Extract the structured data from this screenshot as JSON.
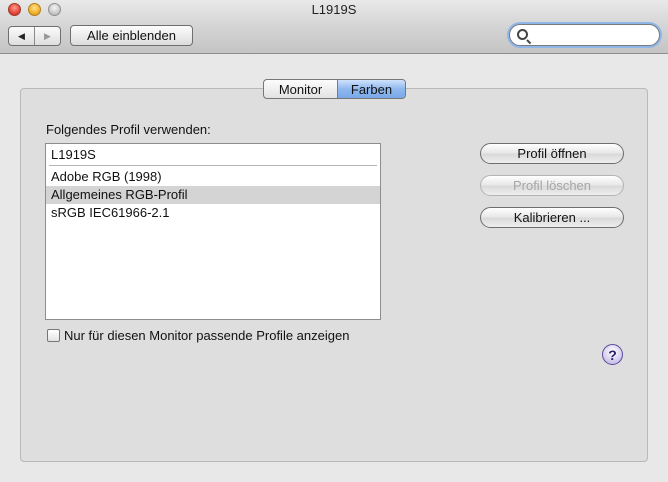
{
  "window": {
    "title": "L1919S"
  },
  "toolbar": {
    "back_icon": "◀",
    "forward_icon": "▶",
    "show_all_label": "Alle einblenden",
    "search_value": "",
    "search_placeholder": ""
  },
  "tabs": [
    {
      "label": "Monitor",
      "selected": false
    },
    {
      "label": "Farben",
      "selected": true
    }
  ],
  "colors": {
    "selected_tab": "#8fb8ee",
    "selected_row": "#d4d4d4",
    "help_button": "#b3a6df"
  },
  "profiles": {
    "label": "Folgendes Profil verwenden:",
    "current": "L1919S",
    "items": [
      "Adobe RGB (1998)",
      "Allgemeines RGB-Profil",
      "sRGB IEC61966-2.1"
    ],
    "selected_index": 1
  },
  "buttons": {
    "open_profile": "Profil öffnen",
    "delete_profile": "Profil löschen",
    "calibrate": "Kalibrieren ..."
  },
  "checkbox": {
    "label": "Nur für diesen Monitor passende Profile anzeigen",
    "checked": false
  },
  "help": {
    "symbol": "?"
  }
}
